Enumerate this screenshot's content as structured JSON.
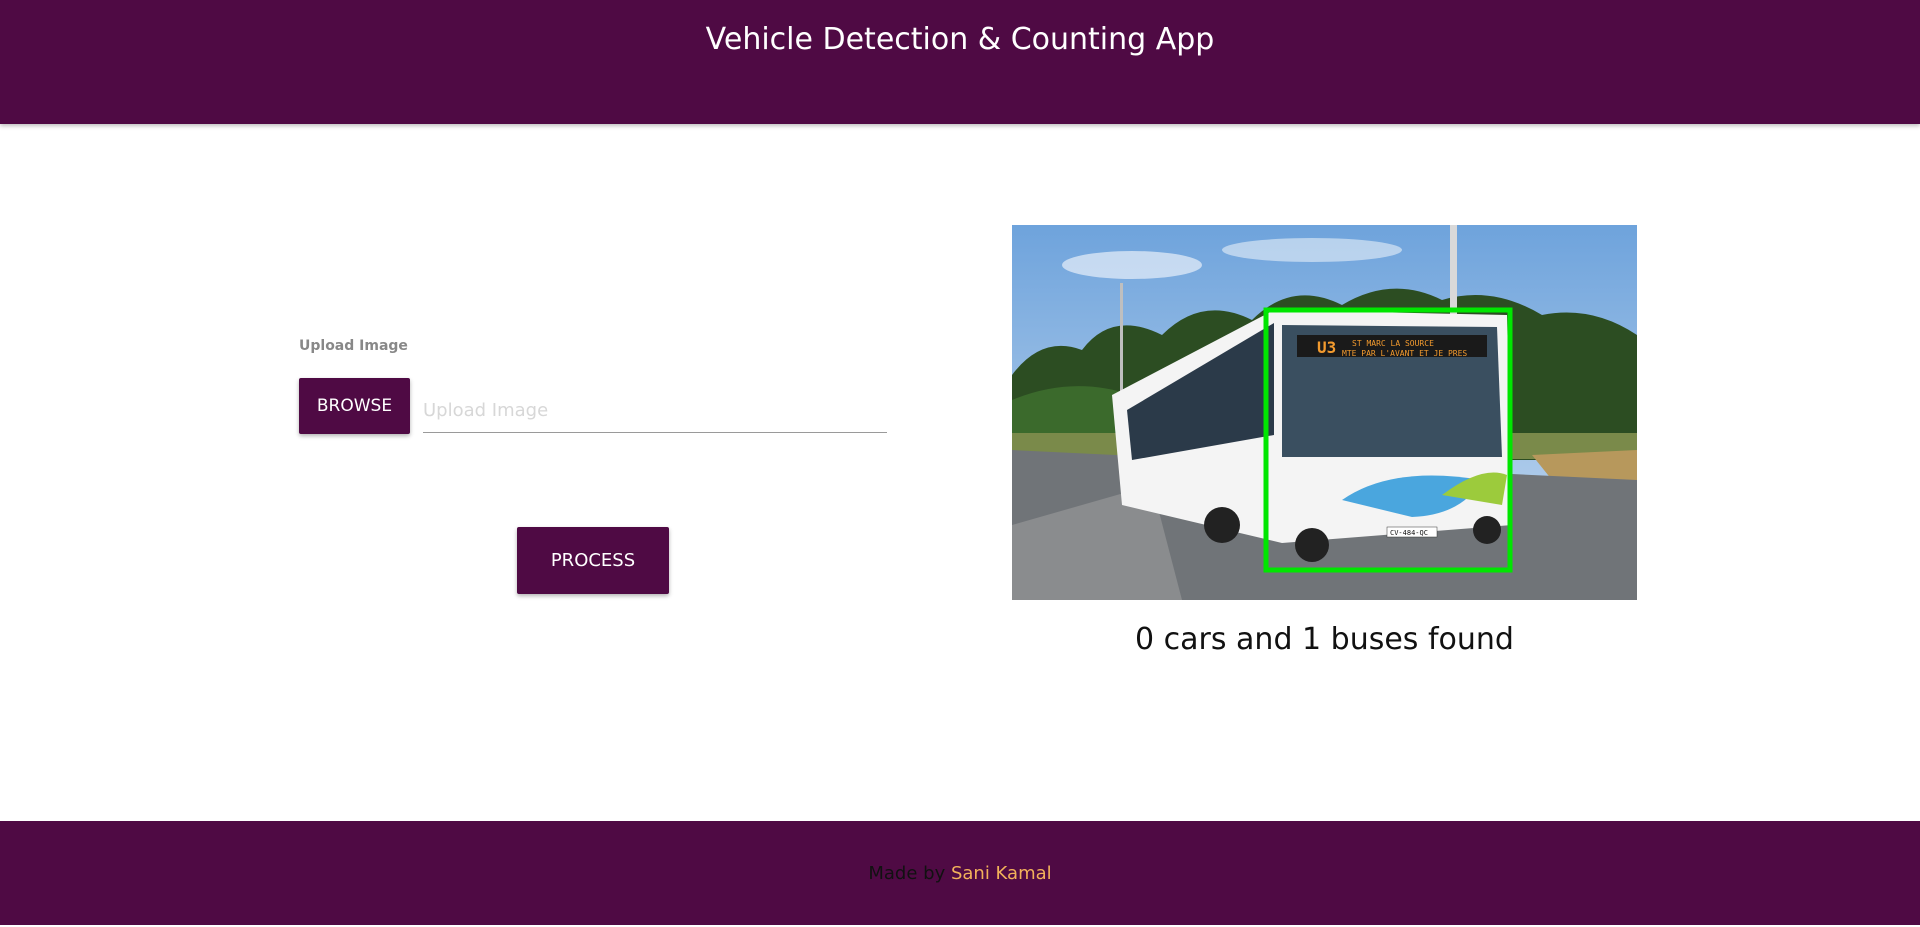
{
  "header": {
    "title": "Vehicle Detection & Counting App",
    "background_color": "#4f0a44"
  },
  "upload": {
    "label": "Upload Image",
    "browse_label": "BROWSE",
    "input_placeholder": "Upload Image",
    "input_value": ""
  },
  "actions": {
    "process_label": "PROCESS"
  },
  "result": {
    "image_description_icon": "bus-detection-image",
    "detection_box_color": "#00e600",
    "bus_sign_route": "U3",
    "bus_sign_line1": "ST MARC  LA SOURCE",
    "bus_sign_line2": "MTE PAR L'AVANT ET JE PRES",
    "bus_plate": "CV-484-QC",
    "summary_text": "0 cars and 1 buses found"
  },
  "footer": {
    "made_by_text": "Made by",
    "author_name": "Sani Kamal",
    "author_color": "#f2b15a"
  }
}
